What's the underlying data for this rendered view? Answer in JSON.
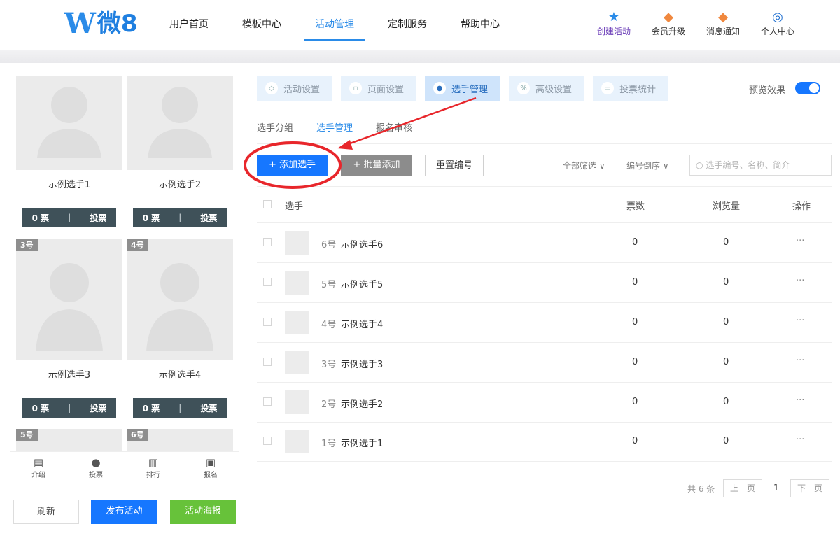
{
  "brand": {
    "logo_w": "W",
    "logo_text": "微8"
  },
  "nav": [
    "用户首页",
    "模板中心",
    "活动管理",
    "定制服务",
    "帮助中心"
  ],
  "user_icons": [
    {
      "label": "创建活动",
      "icon": "star-icon"
    },
    {
      "label": "会员升级",
      "icon": "badge-icon"
    },
    {
      "label": "消息通知",
      "icon": "bell-icon"
    },
    {
      "label": "个人中心",
      "icon": "user-icon"
    }
  ],
  "preview_cards": [
    {
      "name": "示例选手1",
      "badge": "",
      "votes": "0 票",
      "vote_btn": "投票"
    },
    {
      "name": "示例选手2",
      "badge": "",
      "votes": "0 票",
      "vote_btn": "投票"
    },
    {
      "name": "示例选手3",
      "badge": "3号",
      "votes": "0 票",
      "vote_btn": "投票"
    },
    {
      "name": "示例选手4",
      "badge": "4号",
      "votes": "0 票",
      "vote_btn": "投票"
    },
    {
      "name": "",
      "badge": "5号",
      "votes": "",
      "vote_btn": ""
    },
    {
      "name": "",
      "badge": "6号",
      "votes": "",
      "vote_btn": ""
    }
  ],
  "mobile_tabs": [
    "介绍",
    "投票",
    "排行",
    "报名"
  ],
  "left_buttons": {
    "refresh": "刷新",
    "publish": "发布活动",
    "poster": "活动海报"
  },
  "steps": [
    "活动设置",
    "页面设置",
    "选手管理",
    "高级设置",
    "投票统计"
  ],
  "preview_label": "预览效果",
  "preview_toggle_on": true,
  "subtabs": [
    "选手分组",
    "选手管理",
    "报名审核"
  ],
  "actions": {
    "add": "+ 添加选手",
    "batch": "+ 批量添加",
    "reset": "重置编号"
  },
  "filters": {
    "all": "全部筛选 ∨",
    "sort": "编号倒序 ∨"
  },
  "search_placeholder": "选手编号、名称、简介",
  "table_headers": {
    "player": "选手",
    "votes": "票数",
    "views": "浏览量",
    "ops": "操作"
  },
  "rows": [
    {
      "num": "6号",
      "name": "示例选手6",
      "votes": "0",
      "views": "0",
      "ops": "···"
    },
    {
      "num": "5号",
      "name": "示例选手5",
      "votes": "0",
      "views": "0",
      "ops": "···"
    },
    {
      "num": "4号",
      "name": "示例选手4",
      "votes": "0",
      "views": "0",
      "ops": "···"
    },
    {
      "num": "3号",
      "name": "示例选手3",
      "votes": "0",
      "views": "0",
      "ops": "···"
    },
    {
      "num": "2号",
      "name": "示例选手2",
      "votes": "0",
      "views": "0",
      "ops": "···"
    },
    {
      "num": "1号",
      "name": "示例选手1",
      "votes": "0",
      "views": "0",
      "ops": "···"
    }
  ],
  "pagination": {
    "total": "共 6 条",
    "prev": "上一页",
    "page": "1",
    "next": "下一页"
  },
  "colors": {
    "accent": "#2a8be8",
    "primary_btn": "#1677ff",
    "poster_btn": "#67c23a",
    "annotation": "#e8262b"
  }
}
